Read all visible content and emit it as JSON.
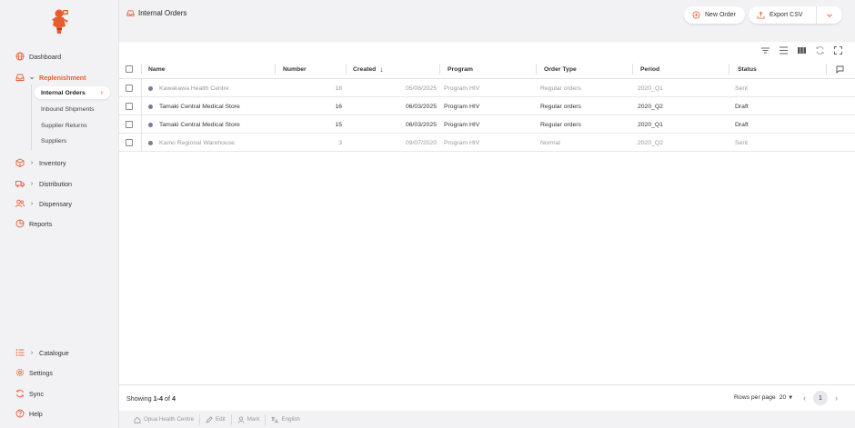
{
  "sidebar": {
    "items": [
      {
        "label": "Dashboard",
        "icon": "globe-icon"
      },
      {
        "label": "Replenishment",
        "icon": "inbox-icon",
        "expanded": true
      },
      {
        "label": "Inventory",
        "icon": "box-icon"
      },
      {
        "label": "Distribution",
        "icon": "truck-icon"
      },
      {
        "label": "Dispensary",
        "icon": "people-icon"
      },
      {
        "label": "Reports",
        "icon": "pie-chart-icon"
      }
    ],
    "subitems": [
      "Internal Orders",
      "Inbound Shipments",
      "Supplier Returns",
      "Suppliers"
    ],
    "bottom": [
      {
        "label": "Catalogue",
        "icon": "list-icon"
      },
      {
        "label": "Settings",
        "icon": "gear-icon"
      },
      {
        "label": "Sync",
        "icon": "sync-icon"
      },
      {
        "label": "Help",
        "icon": "help-icon"
      }
    ]
  },
  "header": {
    "title": "Internal Orders",
    "new_order_label": "New Order",
    "export_label": "Export CSV"
  },
  "table": {
    "columns": [
      "Name",
      "Number",
      "Created",
      "Program",
      "Order Type",
      "Period",
      "Status"
    ],
    "rows": [
      {
        "name": "Kawakawa Health Centre",
        "number": "18",
        "created": "05/08/2025",
        "program": "Program HIV",
        "order_type": "Regular orders",
        "period": "2020_Q1",
        "status": "Sent"
      },
      {
        "name": "Tamaki Central Medical Store",
        "number": "16",
        "created": "06/03/2025",
        "program": "Program HIV",
        "order_type": "Regular orders",
        "period": "2020_Q2",
        "status": "Draft"
      },
      {
        "name": "Tamaki Central Medical Store",
        "number": "15",
        "created": "06/03/2025",
        "program": "Program HIV",
        "order_type": "Regular orders",
        "period": "2020_Q1",
        "status": "Draft"
      },
      {
        "name": "Kamo Regional Warehouse",
        "number": "3",
        "created": "09/07/2020",
        "program": "Program HIV",
        "order_type": "Normal",
        "period": "2020_Q2",
        "status": "Sent"
      }
    ]
  },
  "footer": {
    "showing_prefix": "Showing",
    "range": "1-4",
    "of": "of",
    "total": "4",
    "rows_per_page_label": "Rows per page",
    "rows_per_page_value": "20",
    "current_page": "1"
  },
  "statusbar": {
    "store": "Opua Health Centre",
    "edit": "Edit",
    "user": "Mark",
    "language": "English"
  },
  "colors": {
    "accent": "#e95c30",
    "dot": "#7d7a97",
    "sidebar_bg": "#f2f2f5"
  }
}
